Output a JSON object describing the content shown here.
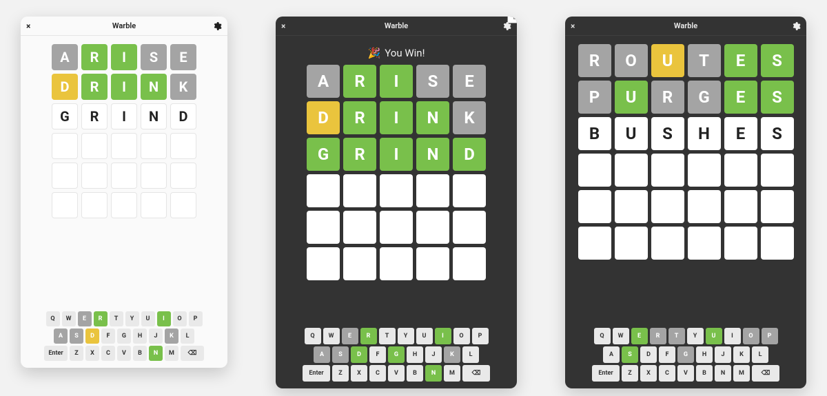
{
  "app_title": "Warble",
  "icons": {
    "close": "×",
    "backspace": "⌫",
    "enter_label": "Enter"
  },
  "colors": {
    "correct": "#79c04b",
    "present": "#eac43d",
    "absent": "#a4a4a4",
    "empty": "#ffffff",
    "dark_bg": "#333333",
    "light_bg": "#fafafa"
  },
  "windows": [
    {
      "id": "win-light",
      "theme": "light",
      "message": null,
      "badge": false,
      "board_total_rows": 6,
      "rows": [
        [
          {
            "l": "A",
            "s": "absent"
          },
          {
            "l": "R",
            "s": "correct"
          },
          {
            "l": "I",
            "s": "correct"
          },
          {
            "l": "S",
            "s": "absent"
          },
          {
            "l": "E",
            "s": "absent"
          }
        ],
        [
          {
            "l": "D",
            "s": "present"
          },
          {
            "l": "R",
            "s": "correct"
          },
          {
            "l": "I",
            "s": "correct"
          },
          {
            "l": "N",
            "s": "correct"
          },
          {
            "l": "K",
            "s": "absent"
          }
        ],
        [
          {
            "l": "G",
            "s": "pending"
          },
          {
            "l": "R",
            "s": "pending"
          },
          {
            "l": "I",
            "s": "pending"
          },
          {
            "l": "N",
            "s": "pending"
          },
          {
            "l": "D",
            "s": "pending"
          }
        ]
      ],
      "keyboard": {
        "Q": "default",
        "W": "default",
        "E": "absent",
        "R": "correct",
        "T": "default",
        "Y": "default",
        "U": "default",
        "I": "correct",
        "O": "default",
        "P": "default",
        "A": "absent",
        "S": "absent",
        "D": "present",
        "F": "default",
        "G": "default",
        "H": "default",
        "J": "default",
        "K": "absent",
        "L": "default",
        "Z": "default",
        "X": "default",
        "C": "default",
        "V": "default",
        "B": "default",
        "N": "correct",
        "M": "default"
      }
    },
    {
      "id": "win-dark-win",
      "theme": "dark",
      "message": "You Win!",
      "message_emoji": "🎉",
      "badge": true,
      "board_total_rows": 6,
      "rows": [
        [
          {
            "l": "A",
            "s": "absent"
          },
          {
            "l": "R",
            "s": "correct"
          },
          {
            "l": "I",
            "s": "correct"
          },
          {
            "l": "S",
            "s": "absent"
          },
          {
            "l": "E",
            "s": "absent"
          }
        ],
        [
          {
            "l": "D",
            "s": "present"
          },
          {
            "l": "R",
            "s": "correct"
          },
          {
            "l": "I",
            "s": "correct"
          },
          {
            "l": "N",
            "s": "correct"
          },
          {
            "l": "K",
            "s": "absent"
          }
        ],
        [
          {
            "l": "G",
            "s": "correct"
          },
          {
            "l": "R",
            "s": "correct"
          },
          {
            "l": "I",
            "s": "correct"
          },
          {
            "l": "N",
            "s": "correct"
          },
          {
            "l": "D",
            "s": "correct"
          }
        ]
      ],
      "keyboard": {
        "Q": "default",
        "W": "default",
        "E": "absent",
        "R": "correct",
        "T": "default",
        "Y": "default",
        "U": "default",
        "I": "correct",
        "O": "default",
        "P": "default",
        "A": "absent",
        "S": "absent",
        "D": "correct",
        "F": "default",
        "G": "correct",
        "H": "default",
        "J": "default",
        "K": "absent",
        "L": "default",
        "Z": "default",
        "X": "default",
        "C": "default",
        "V": "default",
        "B": "default",
        "N": "correct",
        "M": "default"
      }
    },
    {
      "id": "win-dark-play",
      "theme": "dark",
      "message": null,
      "badge": false,
      "board_total_rows": 6,
      "rows": [
        [
          {
            "l": "R",
            "s": "absent"
          },
          {
            "l": "O",
            "s": "absent"
          },
          {
            "l": "U",
            "s": "present"
          },
          {
            "l": "T",
            "s": "absent"
          },
          {
            "l": "E",
            "s": "correct"
          },
          {
            "l": "S",
            "s": "correct"
          }
        ],
        [
          {
            "l": "P",
            "s": "absent"
          },
          {
            "l": "U",
            "s": "correct"
          },
          {
            "l": "R",
            "s": "absent"
          },
          {
            "l": "G",
            "s": "absent"
          },
          {
            "l": "E",
            "s": "correct"
          },
          {
            "l": "S",
            "s": "correct"
          }
        ],
        [
          {
            "l": "B",
            "s": "pending"
          },
          {
            "l": "U",
            "s": "pending"
          },
          {
            "l": "S",
            "s": "pending"
          },
          {
            "l": "H",
            "s": "pending"
          },
          {
            "l": "E",
            "s": "pending"
          },
          {
            "l": "S",
            "s": "pending"
          }
        ]
      ],
      "keyboard": {
        "Q": "default",
        "W": "default",
        "E": "correct",
        "R": "absent",
        "T": "absent",
        "Y": "default",
        "U": "correct",
        "I": "default",
        "O": "absent",
        "P": "absent",
        "A": "default",
        "S": "correct",
        "D": "default",
        "F": "default",
        "G": "absent",
        "H": "default",
        "J": "default",
        "K": "default",
        "L": "default",
        "Z": "default",
        "X": "default",
        "C": "default",
        "V": "default",
        "B": "default",
        "N": "default",
        "M": "default"
      }
    }
  ],
  "keyboard_layout": [
    [
      "Q",
      "W",
      "E",
      "R",
      "T",
      "Y",
      "U",
      "I",
      "O",
      "P"
    ],
    [
      "A",
      "S",
      "D",
      "F",
      "G",
      "H",
      "J",
      "K",
      "L"
    ],
    [
      "Enter",
      "Z",
      "X",
      "C",
      "V",
      "B",
      "N",
      "M",
      "Backspace"
    ]
  ]
}
